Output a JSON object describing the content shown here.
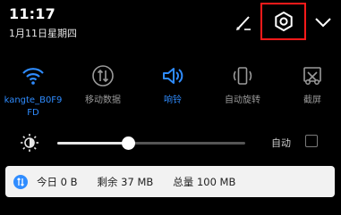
{
  "status": {
    "time": "11:17",
    "date": "1月11日星期四"
  },
  "header_icons": {
    "edit": "pencil-icon",
    "settings": "gear-icon",
    "collapse": "chevron-down-icon"
  },
  "quick_toggles": [
    {
      "label": "kangte_B0F9FD",
      "icon": "wifi-icon",
      "active": true
    },
    {
      "label": "移动数据",
      "icon": "mobile-data-icon",
      "active": false
    },
    {
      "label": "响铃",
      "icon": "speaker-icon",
      "active": true
    },
    {
      "label": "自动旋转",
      "icon": "auto-rotate-icon",
      "active": false
    },
    {
      "label": "截屏",
      "icon": "screenshot-icon",
      "active": false
    }
  ],
  "brightness": {
    "level": 0.38,
    "auto_label": "自动",
    "auto_checked": false
  },
  "data_usage": {
    "today": "今日 0 B",
    "remaining": "剩余 37 MB",
    "total": "总量 100 MB"
  },
  "colors": {
    "active_blue": "#2f8cff",
    "inactive_gray": "#9a9a9a",
    "highlight_red": "#ff1a1a"
  }
}
